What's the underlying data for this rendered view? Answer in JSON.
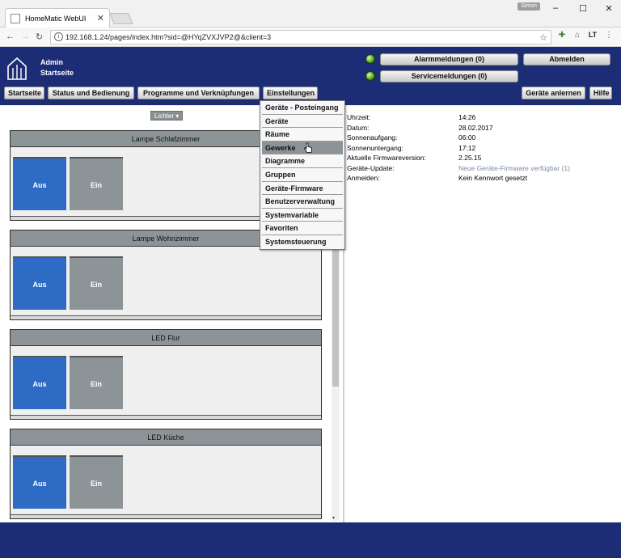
{
  "browser": {
    "tab_title": "HomeMatic WebUI",
    "url": "192.168.1.24/pages/index.htm?sid=@HYqZVXJVP2@&client=3",
    "user_chip": "Simon"
  },
  "header": {
    "user": "Admin",
    "page": "Startseite",
    "alarm_label": "Alarmmeldungen (0)",
    "service_label": "Servicemeldungen (0)",
    "logout_label": "Abmelden",
    "learn_label": "Geräte anlernen",
    "help_label": "Hilfe"
  },
  "menu": [
    {
      "label": "Startseite"
    },
    {
      "label": "Status und Bedienung"
    },
    {
      "label": "Programme und Verknüpfungen"
    },
    {
      "label": "Einstellungen"
    }
  ],
  "filter_label": "Lichter",
  "devices": [
    {
      "name": "Lampe Schlafzimmer",
      "off": "Aus",
      "on": "Ein"
    },
    {
      "name": "Lampe Wohnzimmer",
      "off": "Aus",
      "on": "Ein"
    },
    {
      "name": "LED Flur",
      "off": "Aus",
      "on": "Ein"
    },
    {
      "name": "LED Küche",
      "off": "Aus",
      "on": "Ein"
    }
  ],
  "dropdown": [
    "Geräte - Posteingang",
    "Geräte",
    "Räume",
    "Gewerke",
    "Diagramme",
    "Gruppen",
    "Geräte-Firmware",
    "Benutzerverwaltung",
    "Systemvariable",
    "Favoriten",
    "Systemsteuerung"
  ],
  "dropdown_active": "Gewerke",
  "info": [
    {
      "label": "Uhrzeit:",
      "value": "14:26"
    },
    {
      "label": "Datum:",
      "value": "28.02.2017"
    },
    {
      "label": "Sonnenaufgang:",
      "value": "06:00"
    },
    {
      "label": "Sonnenuntergang:",
      "value": "17:12"
    },
    {
      "label": "Aktuelle Firmwareversion:",
      "value": "2.25.15"
    },
    {
      "label": "Geräte-Update:",
      "value": "Neue Geräte-Firmware verfügbar (1)"
    },
    {
      "label": "Anmelden:",
      "value": "Kein Kennwort gesetzt"
    }
  ],
  "colors": {
    "brand": "#1c2c75",
    "off_button": "#2d6bc4",
    "on_button": "#8d9498"
  }
}
